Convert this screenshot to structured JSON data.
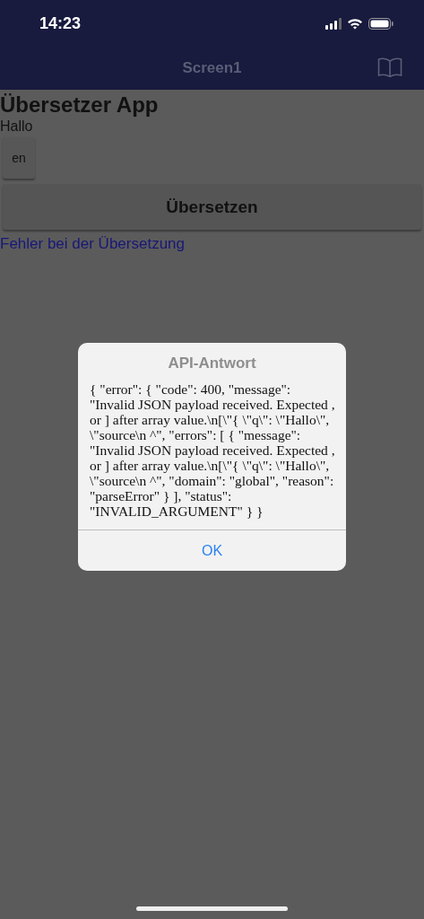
{
  "status_bar": {
    "time": "14:23"
  },
  "nav_bar": {
    "title": "Screen1"
  },
  "app": {
    "title": "Übersetzer App",
    "input_text": "Hallo",
    "language_button": "en",
    "translate_button": "Übersetzen",
    "error_text": "Fehler bei der Übersetzung"
  },
  "dialog": {
    "title": "API-Antwort",
    "message": "{ \"error\": { \"code\": 400, \"message\": \"Invalid JSON payload received. Expected , or ] after array value.\\n[\\\"{ \\\"q\\\": \\\"Hallo\\\", \\\"source\\n ^\", \"errors\": [ { \"message\": \"Invalid JSON payload received. Expected , or ] after array value.\\n[\\\"{ \\\"q\\\": \\\"Hallo\\\", \\\"source\\n ^\", \"domain\": \"global\", \"reason\": \"parseError\" } ], \"status\": \"INVALID_ARGUMENT\" } }",
    "buttons": [
      "OK"
    ]
  }
}
